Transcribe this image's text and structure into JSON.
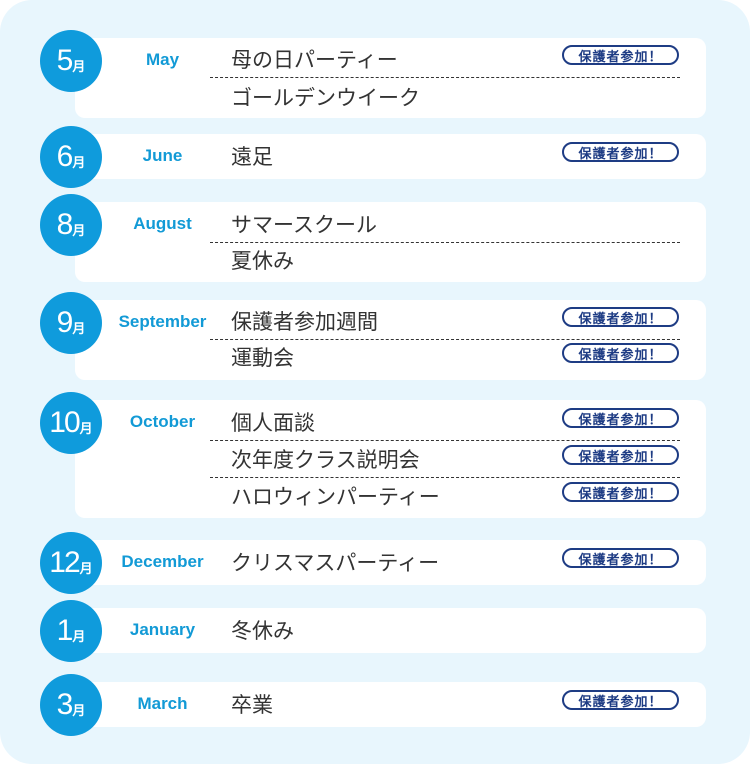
{
  "month_suffix": "月",
  "badge_label": "保護者参加！",
  "colors": {
    "background": "#e8f6fd",
    "accent": "#0f9bdc",
    "badge": "#1e3c84",
    "text": "#333333"
  },
  "months": [
    {
      "num": "5",
      "en": "May",
      "events": [
        {
          "name": "母の日パーティー",
          "badge": true
        },
        {
          "name": "ゴールデンウイーク",
          "badge": false
        }
      ]
    },
    {
      "num": "6",
      "en": "June",
      "events": [
        {
          "name": "遠足",
          "badge": true
        }
      ]
    },
    {
      "num": "8",
      "en": "August",
      "events": [
        {
          "name": "サマースクール",
          "badge": false
        },
        {
          "name": "夏休み",
          "badge": false
        }
      ]
    },
    {
      "num": "9",
      "en": "September",
      "events": [
        {
          "name": "保護者参加週間",
          "badge": true
        },
        {
          "name": "運動会",
          "badge": true
        }
      ]
    },
    {
      "num": "10",
      "en": "October",
      "events": [
        {
          "name": "個人面談",
          "badge": true
        },
        {
          "name": "次年度クラス説明会",
          "badge": true
        },
        {
          "name": "ハロウィンパーティー",
          "badge": true
        }
      ]
    },
    {
      "num": "12",
      "en": "December",
      "events": [
        {
          "name": "クリスマスパーティー",
          "badge": true
        }
      ]
    },
    {
      "num": "1",
      "en": "January",
      "events": [
        {
          "name": "冬休み",
          "badge": false
        }
      ]
    },
    {
      "num": "3",
      "en": "March",
      "events": [
        {
          "name": "卒業",
          "badge": true
        }
      ]
    }
  ]
}
